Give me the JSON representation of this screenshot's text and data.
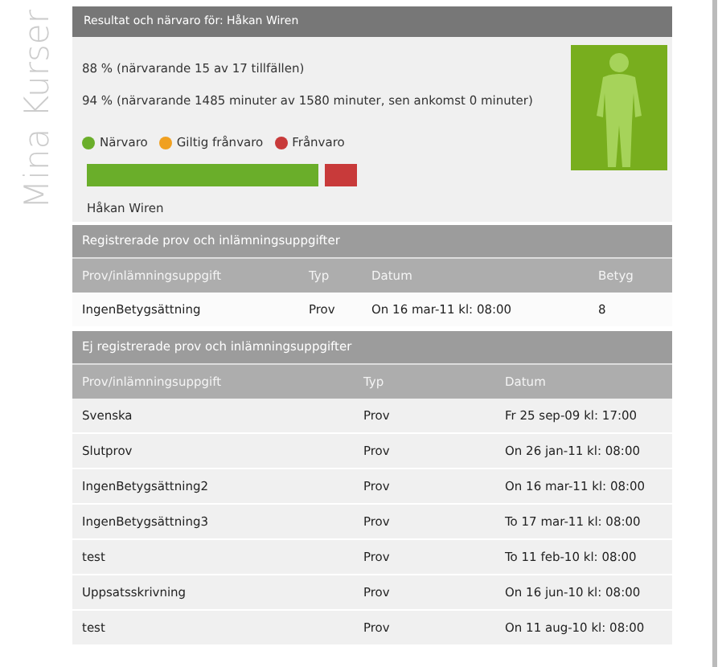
{
  "sidebar_title": "Mina Kurser",
  "summary": {
    "title": "Resultat och närvaro för: Håkan Wiren",
    "lines": [
      "88 % (närvarande 15 av 17 tillfällen)",
      "94 % (närvarande 1485 minuter av 1580 minuter, sen ankomst 0 minuter)"
    ],
    "legend": [
      {
        "label": "Närvaro",
        "color": "#6aae2a"
      },
      {
        "label": "Giltig frånvaro",
        "color": "#f0a020"
      },
      {
        "label": "Frånvaro",
        "color": "#c83a3a"
      }
    ],
    "bar": [
      {
        "color": "#6aae2a",
        "kind": "present"
      },
      {
        "color": "#c83a3a",
        "kind": "absent"
      }
    ],
    "student_name": "Håkan Wiren"
  },
  "sections": [
    {
      "title": "Registrerade prov och inlämningsuppgifter",
      "columns": [
        "Prov/inlämningsuppgift",
        "Typ",
        "Datum",
        "Betyg"
      ],
      "rows": [
        [
          "IngenBetygsättning",
          "Prov",
          "On 16 mar-11 kl: 08:00",
          "8"
        ]
      ]
    },
    {
      "title": "Ej registrerade prov och inlämningsuppgifter",
      "columns": [
        "Prov/inlämningsuppgift",
        "Typ",
        "Datum"
      ],
      "rows": [
        [
          "Svenska",
          "Prov",
          "Fr 25 sep-09 kl: 17:00"
        ],
        [
          "Slutprov",
          "Prov",
          "On 26 jan-11 kl: 08:00"
        ],
        [
          "IngenBetygsättning2",
          "Prov",
          "On 16 mar-11 kl: 08:00"
        ],
        [
          "IngenBetygsättning3",
          "Prov",
          "To 17 mar-11 kl: 08:00"
        ],
        [
          "test",
          "Prov",
          "To 11 feb-10 kl: 08:00"
        ],
        [
          "Uppsatsskrivning",
          "Prov",
          "On 16 jun-10 kl: 08:00"
        ],
        [
          "test",
          "Prov",
          "On 11 aug-10 kl: 08:00"
        ]
      ]
    }
  ]
}
